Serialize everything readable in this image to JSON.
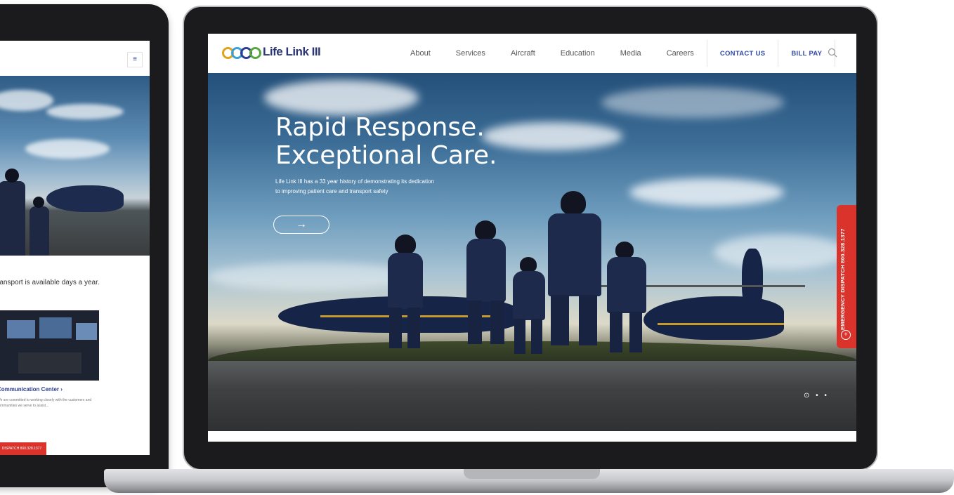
{
  "tablet": {
    "menu_icon": "hamburger-icon",
    "hero_dots": "⊙ • •",
    "transport_text": "ransport is available days a year.",
    "link_label": "Communication Center ›",
    "link_desc": "We are committed to working closely with the customers and communities we serve to assist...",
    "dispatch_label": "DISPATCH 800.328.1377"
  },
  "site": {
    "logo_text": "Life Link III",
    "nav": {
      "items": [
        "About",
        "Services",
        "Aircraft",
        "Education",
        "Media",
        "Careers"
      ],
      "contact_label": "CONTACT US",
      "billpay_label": "BILL PAY",
      "search_icon": "search-icon"
    },
    "hero": {
      "title_line1": "Rapid Response.",
      "title_line2": "Exceptional Care.",
      "subtitle_line1": "Life Link III has a 33 year history of demonstrating its dedication",
      "subtitle_line2": "to improving patient care and transport safety",
      "cta_arrow": "→",
      "dots": "⊙ • •"
    },
    "dispatch_tab": "EMERGENCY DISPATCH 800.328.1377",
    "colors": {
      "brand": "#2b3778",
      "accent": "#2f49a8",
      "dispatch": "#d9332b"
    }
  }
}
